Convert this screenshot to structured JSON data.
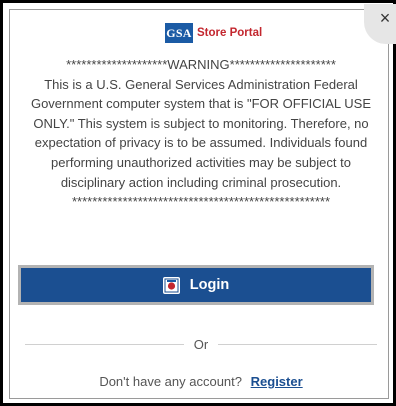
{
  "header": {
    "close_label": "×",
    "logo_mark": "GSA",
    "logo_text": "Store Portal"
  },
  "warning": {
    "title_line": "********************WARNING*********************",
    "lines": [
      "This is a U.S. General Services Administration Federal",
      "Government computer system that is \"FOR OFFICIAL USE",
      "ONLY.\" This system is subject to monitoring. Therefore, no",
      "expectation of privacy is to be assumed. Individuals found",
      "performing unauthorized activities may be subject to",
      "disciplinary action including criminal prosecution."
    ],
    "footer_line": "***************************************************"
  },
  "login": {
    "label": "Login",
    "icon": "login-badge-icon"
  },
  "divider": {
    "label": "Or"
  },
  "register": {
    "prompt": "Don't have any account?",
    "link_label": "Register"
  },
  "colors": {
    "primary": "#1b4f91",
    "brand_blue": "#1b5ba5",
    "brand_red": "#c3272f",
    "text": "#444444"
  }
}
